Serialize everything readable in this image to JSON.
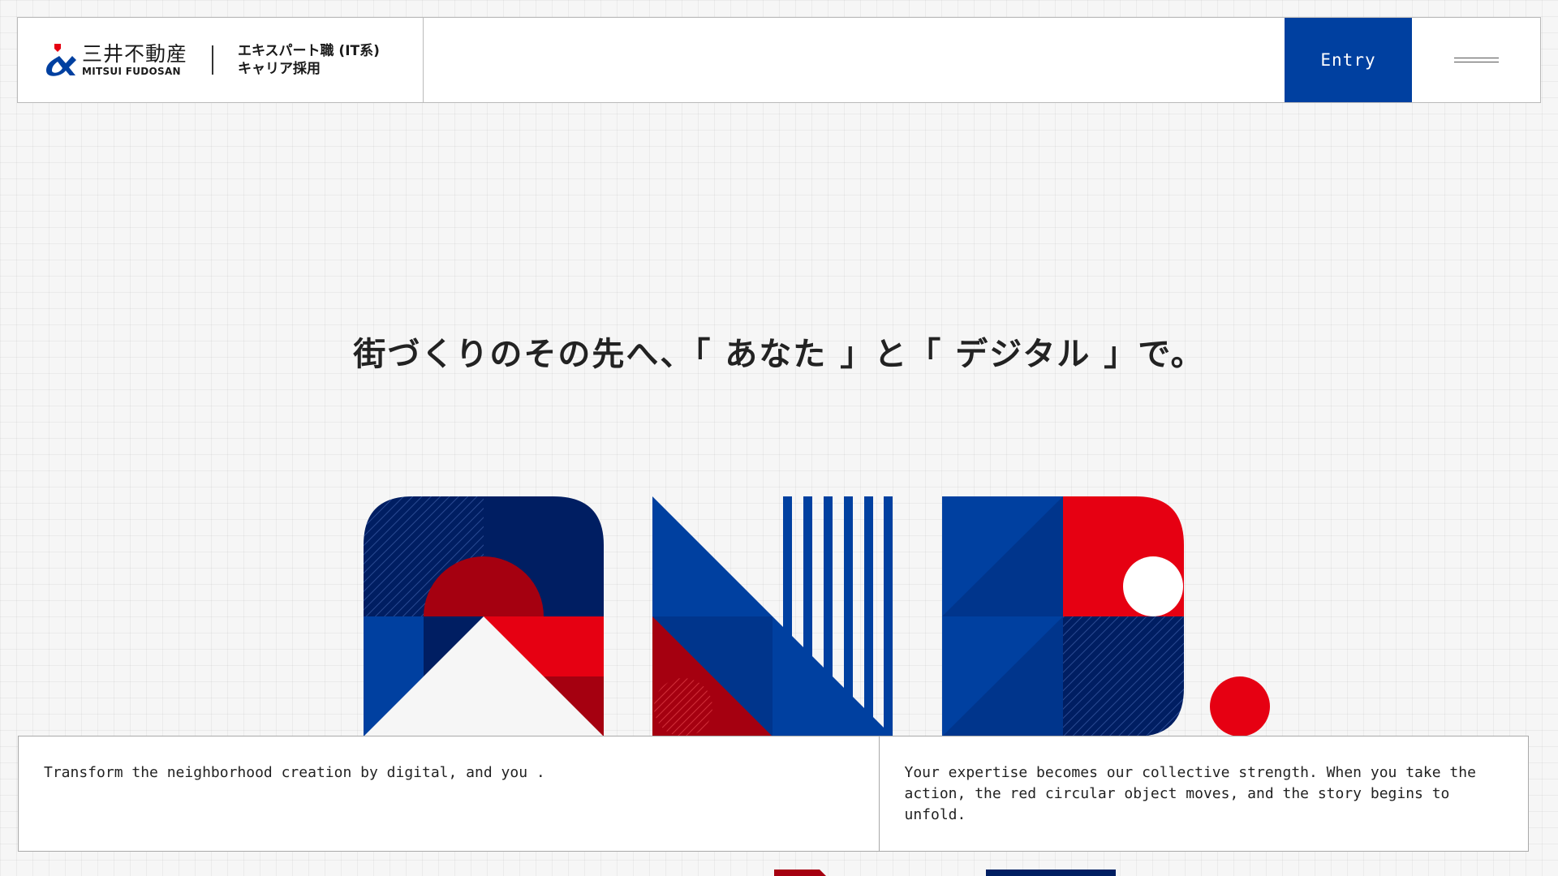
{
  "header": {
    "logo": {
      "icon": "ampersand-logo-icon",
      "name_jp": "三井不動産",
      "name_en": "MITSUI FUDOSAN"
    },
    "subtitle_line1": "エキスパート職 (IT系)",
    "subtitle_line2": "キャリア採用",
    "entry_label": "Entry",
    "menu_icon": "hamburger-menu-icon"
  },
  "hero": {
    "tagline": "街づくりのその先へ、「 あなた 」と「 デジタル 」で。",
    "graphic": "and-geometric-logo"
  },
  "info": {
    "left_text": "Transform the neighborhood creation by digital, and you .",
    "right_text": "Your expertise becomes our collective strength. When you take the action, the red circular object moves, and the story begins to unfold."
  },
  "colors": {
    "navy": "#001e62",
    "blue": "#0040a0",
    "blue_mid": "#00358c",
    "red": "#e60012",
    "dark_red": "#a50010",
    "background": "#f6f6f6"
  }
}
